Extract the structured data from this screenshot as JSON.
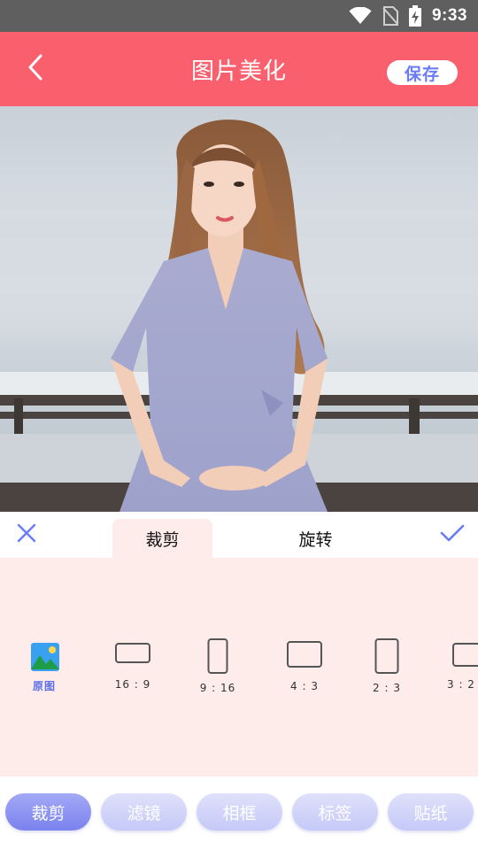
{
  "status_bar": {
    "time": "9:33"
  },
  "header": {
    "title": "图片美化",
    "save_label": "保存"
  },
  "edit_tabs": [
    {
      "label": "裁剪",
      "active": true
    },
    {
      "label": "旋转",
      "active": false
    }
  ],
  "ratios": [
    {
      "label": "原图",
      "icon": "image-icon"
    },
    {
      "label": "16 : 9"
    },
    {
      "label": "9 : 16"
    },
    {
      "label": "4 : 3"
    },
    {
      "label": "2 : 3"
    },
    {
      "label": "3 : 2"
    }
  ],
  "tools": [
    {
      "label": "裁剪",
      "active": true
    },
    {
      "label": "滤镜",
      "active": false
    },
    {
      "label": "相框",
      "active": false
    },
    {
      "label": "标签",
      "active": false
    },
    {
      "label": "贴纸",
      "active": false
    }
  ],
  "colors": {
    "header_bg": "#fa5f6d",
    "accent": "#6a7cf5",
    "panel_bg": "#fdecea",
    "status_bar_bg": "#5f5f5f"
  }
}
